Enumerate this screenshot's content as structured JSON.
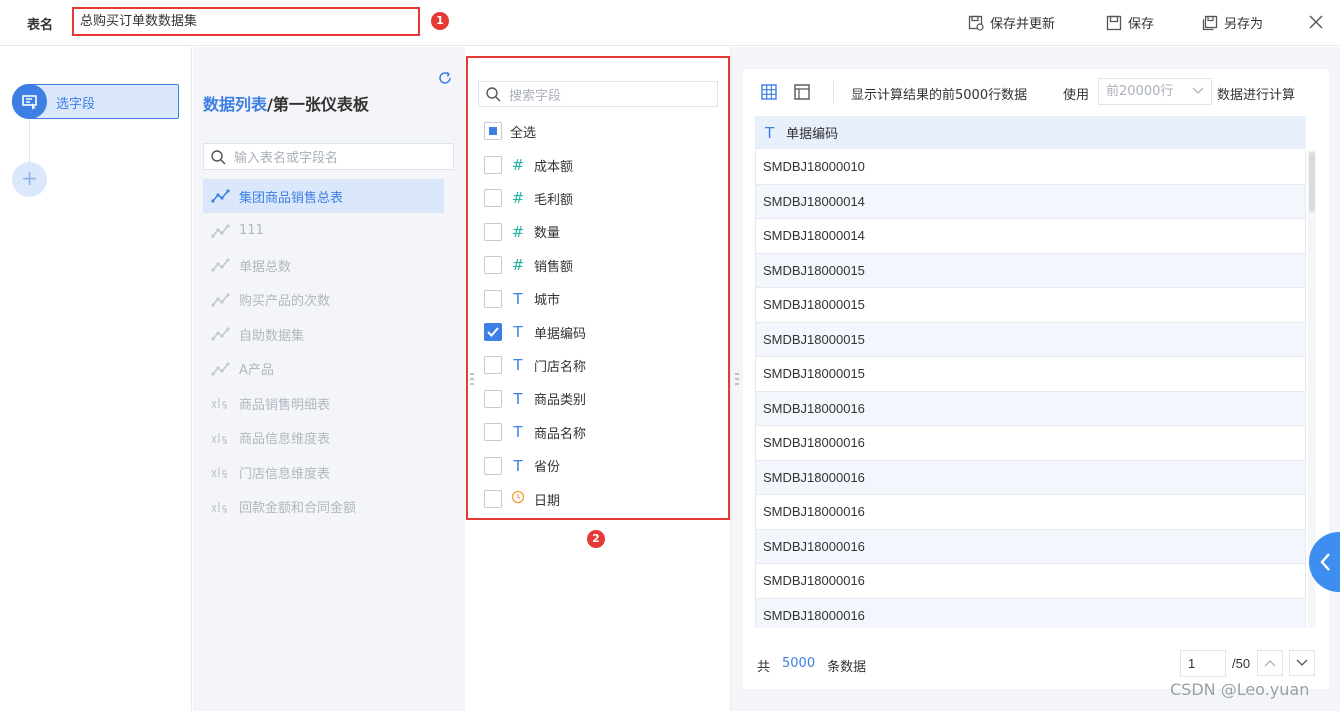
{
  "header": {
    "table_name_label": "表名",
    "table_name_value": "总购买订单数数据集",
    "badge_1": "1",
    "save_update_label": "保存并更新",
    "save_label": "保存",
    "save_as_label": "另存为"
  },
  "steps": {
    "active_label": "选字段",
    "add_label": "+"
  },
  "tables_panel": {
    "title_link": "数据列表",
    "title_sep": "/",
    "title_rest": "第一张仪表板",
    "search_placeholder": "输入表名或字段名",
    "items": [
      {
        "label": "集团商品销售总表",
        "icon": "dataset-icon",
        "selected": true
      },
      {
        "label": "111",
        "icon": "dataset-icon"
      },
      {
        "label": "单据总数",
        "icon": "dataset-icon"
      },
      {
        "label": "购买产品的次数",
        "icon": "dataset-icon"
      },
      {
        "label": "自助数据集",
        "icon": "dataset-icon"
      },
      {
        "label": "A产品",
        "icon": "dataset-icon"
      },
      {
        "label": "商品销售明细表",
        "icon": "xls-icon"
      },
      {
        "label": "商品信息维度表",
        "icon": "xls-icon"
      },
      {
        "label": "门店信息维度表",
        "icon": "xls-icon"
      },
      {
        "label": "回款金额和合同金额",
        "icon": "xls-icon"
      }
    ]
  },
  "fields_panel": {
    "search_placeholder": "搜索字段",
    "select_all_label": "全选",
    "badge_2": "2",
    "fields": [
      {
        "label": "成本额",
        "type": "#"
      },
      {
        "label": "毛利额",
        "type": "#"
      },
      {
        "label": "数量",
        "type": "#"
      },
      {
        "label": "销售额",
        "type": "#"
      },
      {
        "label": "城市",
        "type": "T"
      },
      {
        "label": "单据编码",
        "type": "T",
        "checked": true
      },
      {
        "label": "门店名称",
        "type": "T"
      },
      {
        "label": "商品类别",
        "type": "T"
      },
      {
        "label": "商品名称",
        "type": "T"
      },
      {
        "label": "省份",
        "type": "T"
      },
      {
        "label": "日期",
        "type": "clock-icon"
      }
    ]
  },
  "preview": {
    "show_text": "显示计算结果的前5000行数据",
    "use_text": "使用",
    "rows_select": "前20000行",
    "calc_text": "数据进行计算",
    "column_header_type": "T",
    "column_header": "单据编码",
    "rows": [
      "SMDBJ18000010",
      "SMDBJ18000014",
      "SMDBJ18000014",
      "SMDBJ18000015",
      "SMDBJ18000015",
      "SMDBJ18000015",
      "SMDBJ18000015",
      "SMDBJ18000016",
      "SMDBJ18000016",
      "SMDBJ18000016",
      "SMDBJ18000016",
      "SMDBJ18000016",
      "SMDBJ18000016",
      "SMDBJ18000016"
    ],
    "total_prefix": "共",
    "total_count": "5000",
    "total_suffix": "条数据",
    "page_current": "1",
    "page_total": "/50"
  },
  "watermark": "CSDN @Leo.yuan",
  "colors": {
    "accent": "#3d7fe3",
    "highlight_red": "#e53935",
    "number_type": "#2ab39f"
  }
}
